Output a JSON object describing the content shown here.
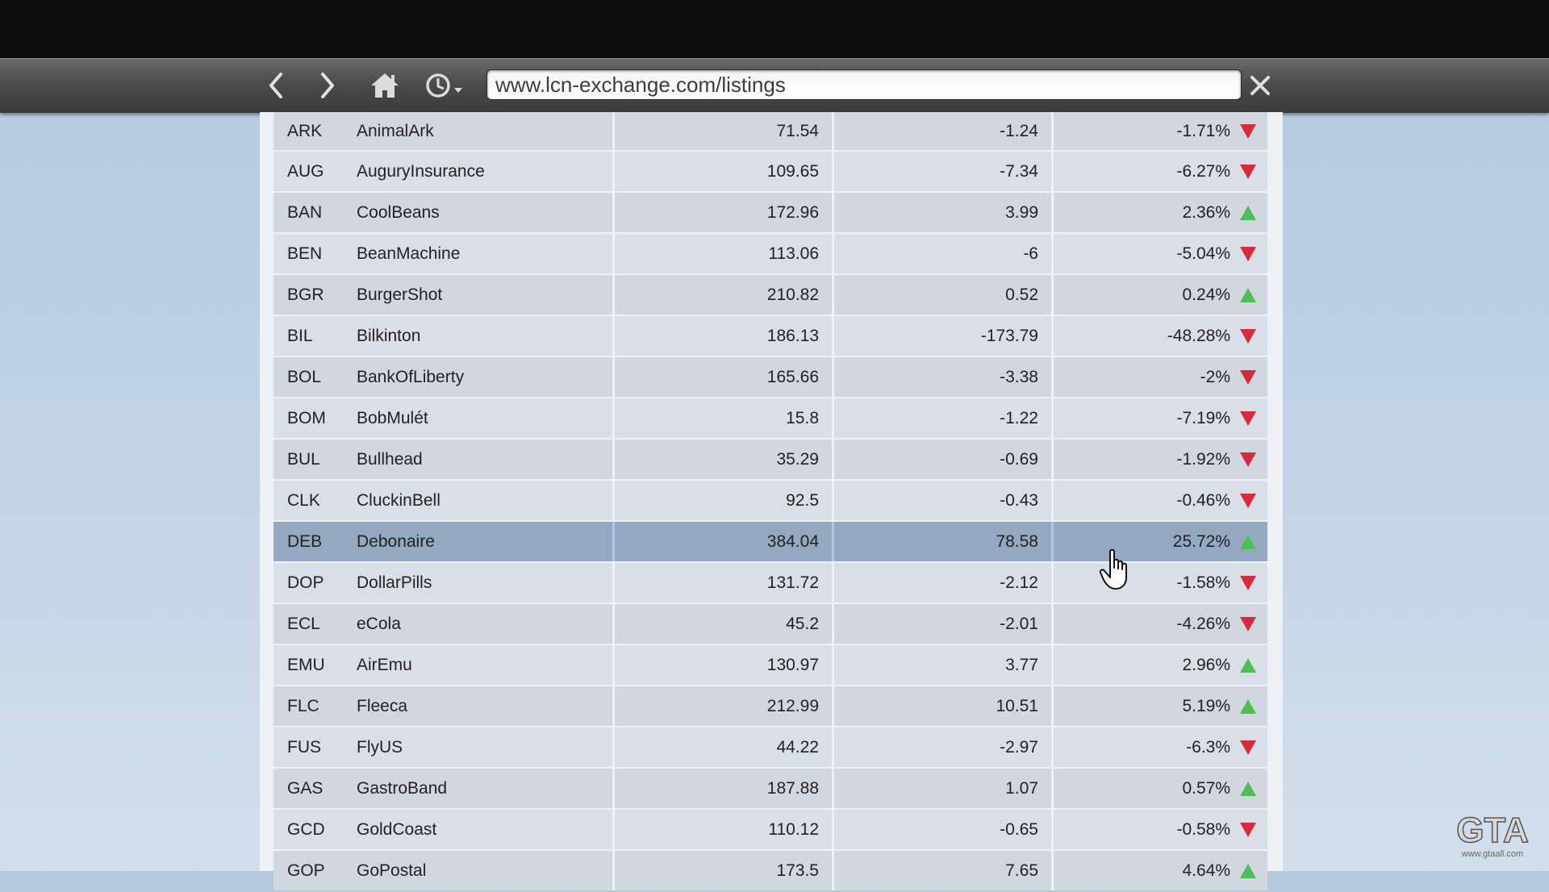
{
  "browser": {
    "url": "www.lcn-exchange.com/listings",
    "icons": [
      "back-icon",
      "forward-icon",
      "home-icon",
      "history-icon",
      "close-icon"
    ]
  },
  "listings": [
    {
      "symbol": "ARK",
      "name": "AnimalArk",
      "price": "71.54",
      "change": "-1.24",
      "percent": "-1.71%",
      "trend": "down"
    },
    {
      "symbol": "AUG",
      "name": "AuguryInsurance",
      "price": "109.65",
      "change": "-7.34",
      "percent": "-6.27%",
      "trend": "down"
    },
    {
      "symbol": "BAN",
      "name": "CoolBeans",
      "price": "172.96",
      "change": "3.99",
      "percent": "2.36%",
      "trend": "up"
    },
    {
      "symbol": "BEN",
      "name": "BeanMachine",
      "price": "113.06",
      "change": "-6",
      "percent": "-5.04%",
      "trend": "down"
    },
    {
      "symbol": "BGR",
      "name": "BurgerShot",
      "price": "210.82",
      "change": "0.52",
      "percent": "0.24%",
      "trend": "up"
    },
    {
      "symbol": "BIL",
      "name": "Bilkinton",
      "price": "186.13",
      "change": "-173.79",
      "percent": "-48.28%",
      "trend": "down"
    },
    {
      "symbol": "BOL",
      "name": "BankOfLiberty",
      "price": "165.66",
      "change": "-3.38",
      "percent": "-2%",
      "trend": "down"
    },
    {
      "symbol": "BOM",
      "name": "BobMulét",
      "price": "15.8",
      "change": "-1.22",
      "percent": "-7.19%",
      "trend": "down"
    },
    {
      "symbol": "BUL",
      "name": "Bullhead",
      "price": "35.29",
      "change": "-0.69",
      "percent": "-1.92%",
      "trend": "down"
    },
    {
      "symbol": "CLK",
      "name": "CluckinBell",
      "price": "92.5",
      "change": "-0.43",
      "percent": "-0.46%",
      "trend": "down"
    },
    {
      "symbol": "DEB",
      "name": "Debonaire",
      "price": "384.04",
      "change": "78.58",
      "percent": "25.72%",
      "trend": "up",
      "highlighted": true
    },
    {
      "symbol": "DOP",
      "name": "DollarPills",
      "price": "131.72",
      "change": "-2.12",
      "percent": "-1.58%",
      "trend": "down"
    },
    {
      "symbol": "ECL",
      "name": "eCola",
      "price": "45.2",
      "change": "-2.01",
      "percent": "-4.26%",
      "trend": "down"
    },
    {
      "symbol": "EMU",
      "name": "AirEmu",
      "price": "130.97",
      "change": "3.77",
      "percent": "2.96%",
      "trend": "up"
    },
    {
      "symbol": "FLC",
      "name": "Fleeca",
      "price": "212.99",
      "change": "10.51",
      "percent": "5.19%",
      "trend": "up"
    },
    {
      "symbol": "FUS",
      "name": "FlyUS",
      "price": "44.22",
      "change": "-2.97",
      "percent": "-6.3%",
      "trend": "down"
    },
    {
      "symbol": "GAS",
      "name": "GastroBand",
      "price": "187.88",
      "change": "1.07",
      "percent": "0.57%",
      "trend": "up"
    },
    {
      "symbol": "GCD",
      "name": "GoldCoast",
      "price": "110.12",
      "change": "-0.65",
      "percent": "-0.58%",
      "trend": "down"
    },
    {
      "symbol": "GOP",
      "name": "GoPostal",
      "price": "173.5",
      "change": "7.65",
      "percent": "4.64%",
      "trend": "up"
    }
  ],
  "colors": {
    "up": "#4fbe55",
    "down": "#d9293a",
    "highlight": "#93a9c2"
  },
  "watermark": {
    "text": "GTA",
    "subtext": "www.gtaall.com"
  }
}
